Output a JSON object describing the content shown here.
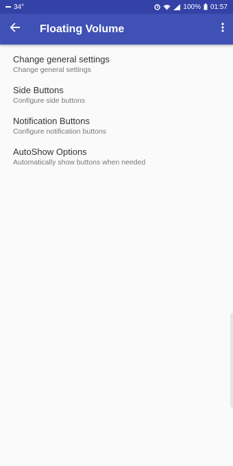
{
  "status_bar": {
    "left_text": "34°",
    "battery": "100%",
    "time": "01:57"
  },
  "app_bar": {
    "title": "Floating Volume"
  },
  "settings": [
    {
      "title": "Change general settings",
      "summary": "Change general settings"
    },
    {
      "title": "Side Buttons",
      "summary": "Configure side buttons"
    },
    {
      "title": "Notification Buttons",
      "summary": "Configure notification buttons"
    },
    {
      "title": "AutoShow Options",
      "summary": "Automatically show buttons when needed"
    }
  ],
  "icons": [
    "back-arrow-icon",
    "overflow-menu-icon",
    "wifi-icon",
    "signal-icon",
    "battery-icon",
    "alarm-icon",
    "notification-icon"
  ],
  "colors": {
    "status_bar": "#3442a8",
    "app_bar": "#3f51b5",
    "background": "#fafafa"
  }
}
